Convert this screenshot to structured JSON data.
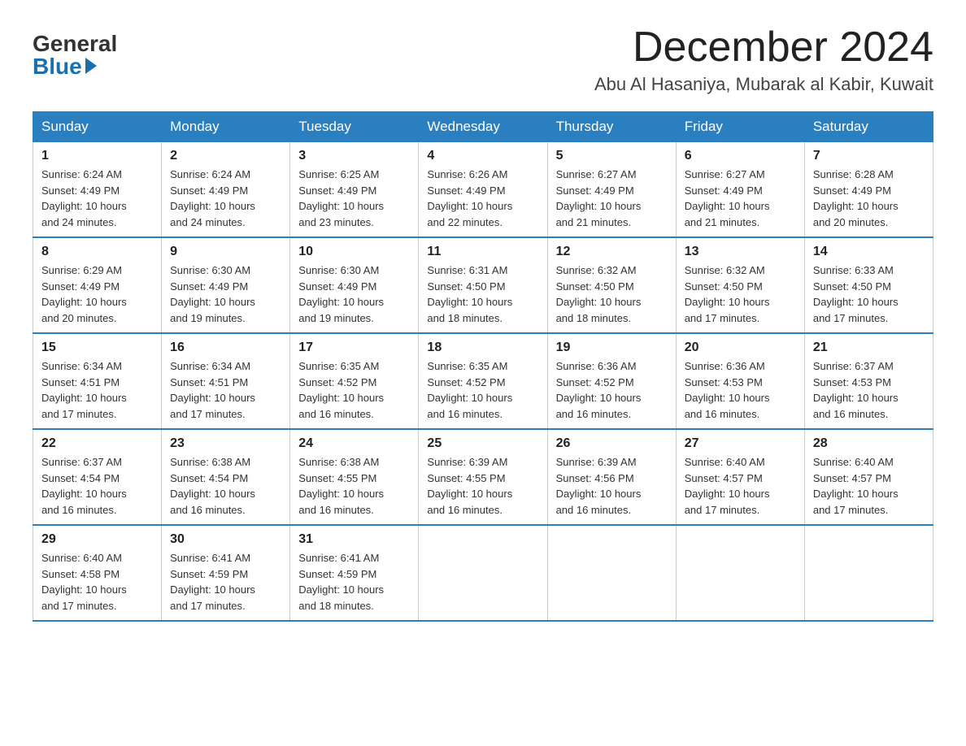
{
  "logo": {
    "general": "General",
    "blue": "Blue"
  },
  "header": {
    "month": "December 2024",
    "location": "Abu Al Hasaniya, Mubarak al Kabir, Kuwait"
  },
  "weekdays": [
    "Sunday",
    "Monday",
    "Tuesday",
    "Wednesday",
    "Thursday",
    "Friday",
    "Saturday"
  ],
  "weeks": [
    [
      {
        "day": "1",
        "info": "Sunrise: 6:24 AM\nSunset: 4:49 PM\nDaylight: 10 hours\nand 24 minutes."
      },
      {
        "day": "2",
        "info": "Sunrise: 6:24 AM\nSunset: 4:49 PM\nDaylight: 10 hours\nand 24 minutes."
      },
      {
        "day": "3",
        "info": "Sunrise: 6:25 AM\nSunset: 4:49 PM\nDaylight: 10 hours\nand 23 minutes."
      },
      {
        "day": "4",
        "info": "Sunrise: 6:26 AM\nSunset: 4:49 PM\nDaylight: 10 hours\nand 22 minutes."
      },
      {
        "day": "5",
        "info": "Sunrise: 6:27 AM\nSunset: 4:49 PM\nDaylight: 10 hours\nand 21 minutes."
      },
      {
        "day": "6",
        "info": "Sunrise: 6:27 AM\nSunset: 4:49 PM\nDaylight: 10 hours\nand 21 minutes."
      },
      {
        "day": "7",
        "info": "Sunrise: 6:28 AM\nSunset: 4:49 PM\nDaylight: 10 hours\nand 20 minutes."
      }
    ],
    [
      {
        "day": "8",
        "info": "Sunrise: 6:29 AM\nSunset: 4:49 PM\nDaylight: 10 hours\nand 20 minutes."
      },
      {
        "day": "9",
        "info": "Sunrise: 6:30 AM\nSunset: 4:49 PM\nDaylight: 10 hours\nand 19 minutes."
      },
      {
        "day": "10",
        "info": "Sunrise: 6:30 AM\nSunset: 4:49 PM\nDaylight: 10 hours\nand 19 minutes."
      },
      {
        "day": "11",
        "info": "Sunrise: 6:31 AM\nSunset: 4:50 PM\nDaylight: 10 hours\nand 18 minutes."
      },
      {
        "day": "12",
        "info": "Sunrise: 6:32 AM\nSunset: 4:50 PM\nDaylight: 10 hours\nand 18 minutes."
      },
      {
        "day": "13",
        "info": "Sunrise: 6:32 AM\nSunset: 4:50 PM\nDaylight: 10 hours\nand 17 minutes."
      },
      {
        "day": "14",
        "info": "Sunrise: 6:33 AM\nSunset: 4:50 PM\nDaylight: 10 hours\nand 17 minutes."
      }
    ],
    [
      {
        "day": "15",
        "info": "Sunrise: 6:34 AM\nSunset: 4:51 PM\nDaylight: 10 hours\nand 17 minutes."
      },
      {
        "day": "16",
        "info": "Sunrise: 6:34 AM\nSunset: 4:51 PM\nDaylight: 10 hours\nand 17 minutes."
      },
      {
        "day": "17",
        "info": "Sunrise: 6:35 AM\nSunset: 4:52 PM\nDaylight: 10 hours\nand 16 minutes."
      },
      {
        "day": "18",
        "info": "Sunrise: 6:35 AM\nSunset: 4:52 PM\nDaylight: 10 hours\nand 16 minutes."
      },
      {
        "day": "19",
        "info": "Sunrise: 6:36 AM\nSunset: 4:52 PM\nDaylight: 10 hours\nand 16 minutes."
      },
      {
        "day": "20",
        "info": "Sunrise: 6:36 AM\nSunset: 4:53 PM\nDaylight: 10 hours\nand 16 minutes."
      },
      {
        "day": "21",
        "info": "Sunrise: 6:37 AM\nSunset: 4:53 PM\nDaylight: 10 hours\nand 16 minutes."
      }
    ],
    [
      {
        "day": "22",
        "info": "Sunrise: 6:37 AM\nSunset: 4:54 PM\nDaylight: 10 hours\nand 16 minutes."
      },
      {
        "day": "23",
        "info": "Sunrise: 6:38 AM\nSunset: 4:54 PM\nDaylight: 10 hours\nand 16 minutes."
      },
      {
        "day": "24",
        "info": "Sunrise: 6:38 AM\nSunset: 4:55 PM\nDaylight: 10 hours\nand 16 minutes."
      },
      {
        "day": "25",
        "info": "Sunrise: 6:39 AM\nSunset: 4:55 PM\nDaylight: 10 hours\nand 16 minutes."
      },
      {
        "day": "26",
        "info": "Sunrise: 6:39 AM\nSunset: 4:56 PM\nDaylight: 10 hours\nand 16 minutes."
      },
      {
        "day": "27",
        "info": "Sunrise: 6:40 AM\nSunset: 4:57 PM\nDaylight: 10 hours\nand 17 minutes."
      },
      {
        "day": "28",
        "info": "Sunrise: 6:40 AM\nSunset: 4:57 PM\nDaylight: 10 hours\nand 17 minutes."
      }
    ],
    [
      {
        "day": "29",
        "info": "Sunrise: 6:40 AM\nSunset: 4:58 PM\nDaylight: 10 hours\nand 17 minutes."
      },
      {
        "day": "30",
        "info": "Sunrise: 6:41 AM\nSunset: 4:59 PM\nDaylight: 10 hours\nand 17 minutes."
      },
      {
        "day": "31",
        "info": "Sunrise: 6:41 AM\nSunset: 4:59 PM\nDaylight: 10 hours\nand 18 minutes."
      },
      {
        "day": "",
        "info": ""
      },
      {
        "day": "",
        "info": ""
      },
      {
        "day": "",
        "info": ""
      },
      {
        "day": "",
        "info": ""
      }
    ]
  ]
}
